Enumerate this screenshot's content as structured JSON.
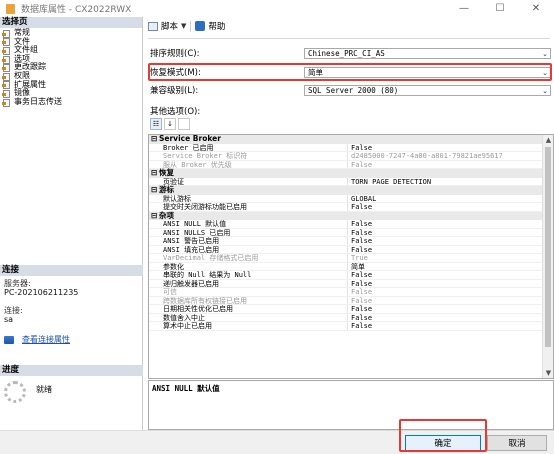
{
  "window": {
    "title": "数据库属性 - CX2022RWX",
    "minimize": "—",
    "maximize": "☐",
    "close": "✕"
  },
  "left_pane": {
    "select_page_header": "选择页",
    "pages": [
      "常规",
      "文件",
      "文件组",
      "选项",
      "更改跟踪",
      "权限",
      "扩展属性",
      "镜像",
      "事务日志传送"
    ],
    "connection_header": "连接",
    "server_label": "服务器:",
    "server_value": "PC-202106211235",
    "conn_label": "连接:",
    "conn_value": "sa",
    "view_conn_link": "查看连接属性",
    "progress_header": "进度",
    "progress_status": "就绪"
  },
  "toolbar": {
    "script_label": "脚本",
    "help_label": "帮助"
  },
  "options": {
    "collation_label": "排序规则(C):",
    "collation_value": "Chinese_PRC_CI_AS",
    "recovery_label": "恢复模式(M):",
    "recovery_value": "简单",
    "compat_label": "兼容级别(L):",
    "compat_value": "SQL Server 2000 (80)",
    "other_label": "其他选项(O):"
  },
  "grid": {
    "categories": [
      {
        "name": "Service Broker",
        "rows": [
          {
            "name": "Broker 已启用",
            "value": "False",
            "dim": false
          },
          {
            "name": "Service Broker 标识符",
            "value": "d2485000-7247-4a00-a801-79821ae95617",
            "dim": true
          },
          {
            "name": "服从 Broker 优先级",
            "value": "False",
            "dim": true
          }
        ]
      },
      {
        "name": "恢复",
        "rows": [
          {
            "name": "页验证",
            "value": "TORN_PAGE_DETECTION",
            "dim": false
          }
        ]
      },
      {
        "name": "游标",
        "rows": [
          {
            "name": "默认游标",
            "value": "GLOBAL",
            "dim": false
          },
          {
            "name": "提交时关闭游标功能已启用",
            "value": "False",
            "dim": false
          }
        ]
      },
      {
        "name": "杂项",
        "rows": [
          {
            "name": "ANSI NULL 默认值",
            "value": "False",
            "dim": false
          },
          {
            "name": "ANSI NULLS 已启用",
            "value": "False",
            "dim": false
          },
          {
            "name": "ANSI 警告已启用",
            "value": "False",
            "dim": false
          },
          {
            "name": "ANSI 填充已启用",
            "value": "False",
            "dim": false
          },
          {
            "name": "VarDecimal 存储格式已启用",
            "value": "True",
            "dim": true
          },
          {
            "name": "参数化",
            "value": "简单",
            "dim": false
          },
          {
            "name": "串联的 Null 结果为 Null",
            "value": "False",
            "dim": false
          },
          {
            "name": "递归触发器已启用",
            "value": "False",
            "dim": false
          },
          {
            "name": "可信",
            "value": "False",
            "dim": true
          },
          {
            "name": "跨数据库所有权链接已启用",
            "value": "False",
            "dim": true
          },
          {
            "name": "日期相关性优化已启用",
            "value": "False",
            "dim": false
          },
          {
            "name": "数值舍入中止",
            "value": "False",
            "dim": false
          },
          {
            "name": "算术中止已启用",
            "value": "False",
            "dim": false
          }
        ]
      }
    ]
  },
  "description": "ANSI NULL 默认值",
  "buttons": {
    "ok": "确定",
    "cancel": "取消"
  }
}
